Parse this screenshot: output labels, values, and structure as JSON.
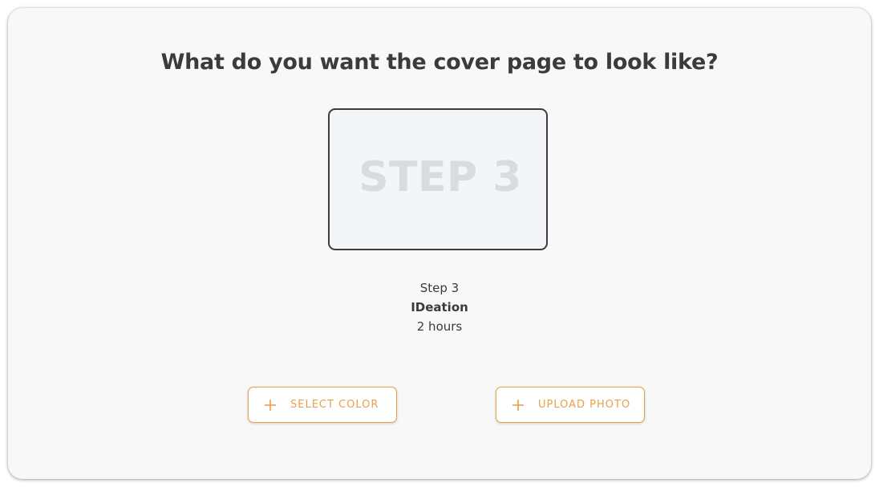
{
  "heading": "What do you want the cover page to look like?",
  "cover": {
    "placeholder_text": "STEP 3"
  },
  "step": {
    "label": "Step 3",
    "name": "IDeation",
    "duration": "2 hours"
  },
  "actions": {
    "select_color": "SELECT COLOR",
    "upload_photo": "UPLOAD PHOTO"
  },
  "icons": {
    "select_color": "plus-icon",
    "upload_photo": "plus-icon"
  },
  "colors": {
    "accent": "#e8a04c",
    "title": "#3a3b3c",
    "card_background": "#f8f8f8",
    "cover_background": "#f4f5f9",
    "cover_text": "#d9dbe1"
  }
}
